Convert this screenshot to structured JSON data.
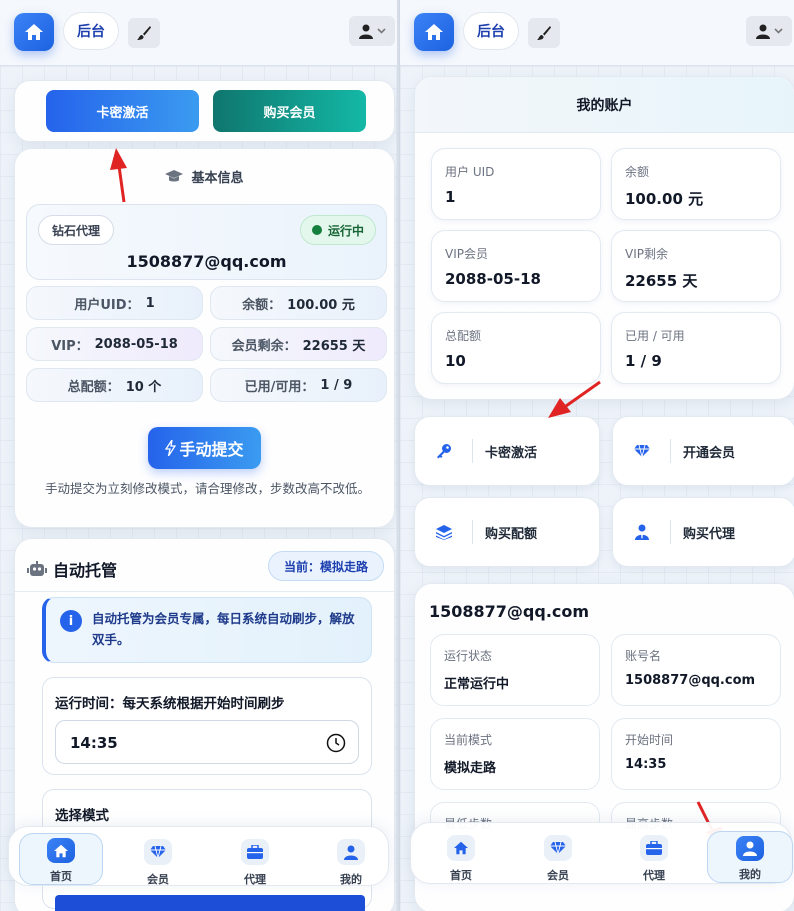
{
  "left": {
    "topbar": {
      "backend_label": "后台"
    },
    "actions": {
      "activate_card": "卡密激活",
      "buy_member": "购买会员"
    },
    "basic_info": {
      "title": "基本信息",
      "level_badge": "钻石代理",
      "status_badge": "运行中",
      "email": "1508877@qq.com",
      "cells": [
        {
          "key": "用户UID：",
          "value": "1"
        },
        {
          "key": "余额：",
          "value": "100.00 元"
        },
        {
          "key": "VIP：",
          "value": "2088-05-18"
        },
        {
          "key": "会员剩余：",
          "value": "22655 天"
        },
        {
          "key": "总配额：",
          "value": "10 个"
        },
        {
          "key": "已用/可用：",
          "value": "1 / 9"
        }
      ],
      "manual_submit": "手动提交",
      "manual_note": "手动提交为立刻修改模式，请合理修改，步数改高不改低。"
    },
    "auto": {
      "title": "自动托管",
      "current_mode": "当前：模拟走路",
      "notice": "自动托管为会员专属，每日系统自动刷步，解放双手。",
      "run_time_label": "运行时间：每天系统根据开始时间刷步",
      "run_time_value": "14:35",
      "select_mode_label": "选择模式"
    }
  },
  "right": {
    "topbar": {
      "backend_label": "后台"
    },
    "account": {
      "title": "我的账户",
      "tiles": [
        {
          "key": "用户 UID",
          "value": "1"
        },
        {
          "key": "余额",
          "value": "100.00 元"
        },
        {
          "key": "VIP会员",
          "value": "2088-05-18"
        },
        {
          "key": "VIP剩余",
          "value": "22655 天"
        },
        {
          "key": "总配额",
          "value": "10"
        },
        {
          "key": "已用 / 可用",
          "value": "1 / 9"
        }
      ]
    },
    "actions": [
      {
        "label": "卡密激活",
        "icon": "key-icon"
      },
      {
        "label": "开通会员",
        "icon": "diamond-icon"
      },
      {
        "label": "购买配额",
        "icon": "layers-icon"
      },
      {
        "label": "购买代理",
        "icon": "agent-icon"
      }
    ],
    "detail": {
      "email": "1508877@qq.com",
      "tiles": [
        {
          "key": "运行状态",
          "value": "正常运行中"
        },
        {
          "key": "账号名",
          "value": "1508877@qq.com"
        },
        {
          "key": "当前模式",
          "value": "模拟走路"
        },
        {
          "key": "开始时间",
          "value": "14:35"
        },
        {
          "key": "最低步数",
          "value": ""
        },
        {
          "key": "最高步数",
          "value": ""
        }
      ]
    }
  },
  "tabbar": {
    "items": [
      {
        "label": "首页"
      },
      {
        "label": "会员"
      },
      {
        "label": "代理"
      },
      {
        "label": "我的"
      }
    ]
  },
  "colors": {
    "accent": "#2563eb",
    "teal": "#14a38b",
    "annotation": "#e02424"
  }
}
